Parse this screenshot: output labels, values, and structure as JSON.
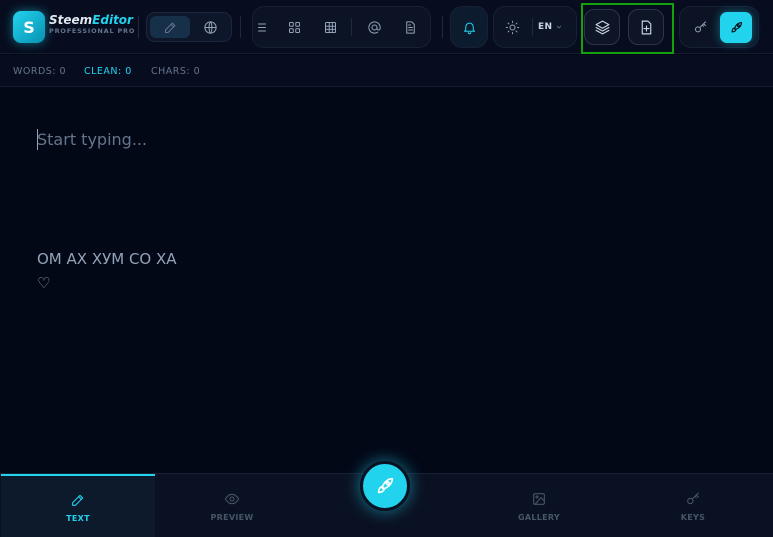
{
  "brand": {
    "logo_letter": "S",
    "name_part1": "Steem",
    "name_part2": "Editor",
    "subtitle": "PROFESSIONAL PRO"
  },
  "toolbar": {
    "mode_icons": [
      "pencil-icon",
      "globe-icon"
    ],
    "insert_icons": [
      "list-icon",
      "grid-icon",
      "table-icon",
      "at-icon",
      "document-icon"
    ],
    "bell_icon": "bell-icon",
    "theme_icon": "sun-icon",
    "language": "EN",
    "highlighted_icons": [
      "layers-icon",
      "file-plus-icon"
    ],
    "key_icon": "key-icon",
    "publish_icon": "rocket-icon"
  },
  "status": {
    "words": "WORDS: 0",
    "clean": "CLEAN: 0",
    "chars": "CHARS: 0"
  },
  "editor": {
    "placeholder": "Start typing...",
    "lines": [
      "ОМ АХ ХУМ СО ХА",
      "♡"
    ]
  },
  "bottom_nav": {
    "tabs": [
      {
        "label": "TEXT",
        "icon": "pencil-icon",
        "active": true
      },
      {
        "label": "PREVIEW",
        "icon": "eye-icon",
        "active": false
      },
      {
        "label": "GALLERY",
        "icon": "image-icon",
        "active": false
      },
      {
        "label": "KEYS",
        "icon": "key-icon",
        "active": false
      }
    ],
    "fab_icon": "rocket-icon"
  },
  "colors": {
    "accent": "#22d3ee",
    "background": "#030817",
    "highlight_box": "#13a10e"
  }
}
